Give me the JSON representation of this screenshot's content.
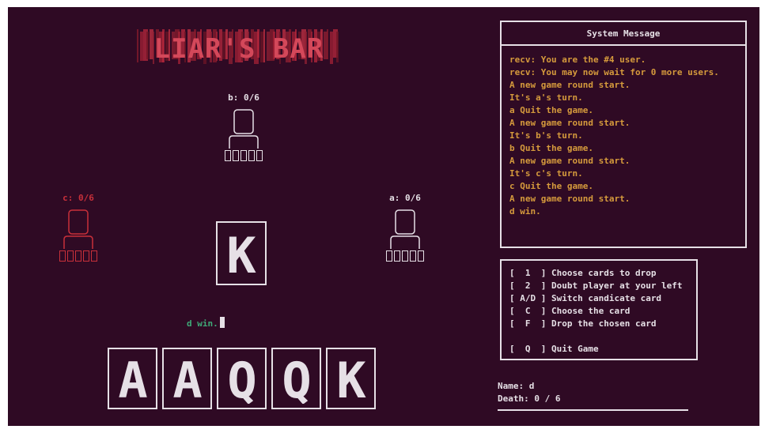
{
  "game_title": "LIAR'S BAR",
  "players": {
    "top": {
      "label": "b: 0/6",
      "card_count": 5
    },
    "left": {
      "label": "c: 0/6",
      "card_count": 5
    },
    "right": {
      "label": "a: 0/6",
      "card_count": 5
    }
  },
  "table_card": "K",
  "status_message": "d win.",
  "hand": [
    "A",
    "A",
    "Q",
    "Q",
    "K"
  ],
  "system": {
    "title": "System Message",
    "messages": [
      "recv: You are the #4 user.",
      "recv: You may now wait for 0 more users.",
      "A new game round start.",
      "It's a's turn.",
      "a Quit the game.",
      "A new game round start.",
      "It's b's turn.",
      "b Quit the game.",
      "A new game round start.",
      "It's c's turn.",
      "c Quit the game.",
      "A new game round start.",
      "d win."
    ]
  },
  "controls": [
    {
      "key": "[  1  ]",
      "action": "Choose cards to drop"
    },
    {
      "key": "[  2  ]",
      "action": "Doubt player at your left"
    },
    {
      "key": "[ A/D ]",
      "action": "Switch candicate card"
    },
    {
      "key": "[  C  ]",
      "action": "Choose the card"
    },
    {
      "key": "[  F  ]",
      "action": "Drop the chosen card"
    },
    {
      "key": "[  Q  ]",
      "action": "Quit Game"
    }
  ],
  "info": {
    "name": "Name: d",
    "death": "Death: 0 / 6"
  },
  "colors": {
    "background": "#2f0a24",
    "foreground": "#e6e0e6",
    "accent_red": "#c8303a",
    "message_orange": "#d59a3c",
    "status_green": "#3faa78"
  }
}
